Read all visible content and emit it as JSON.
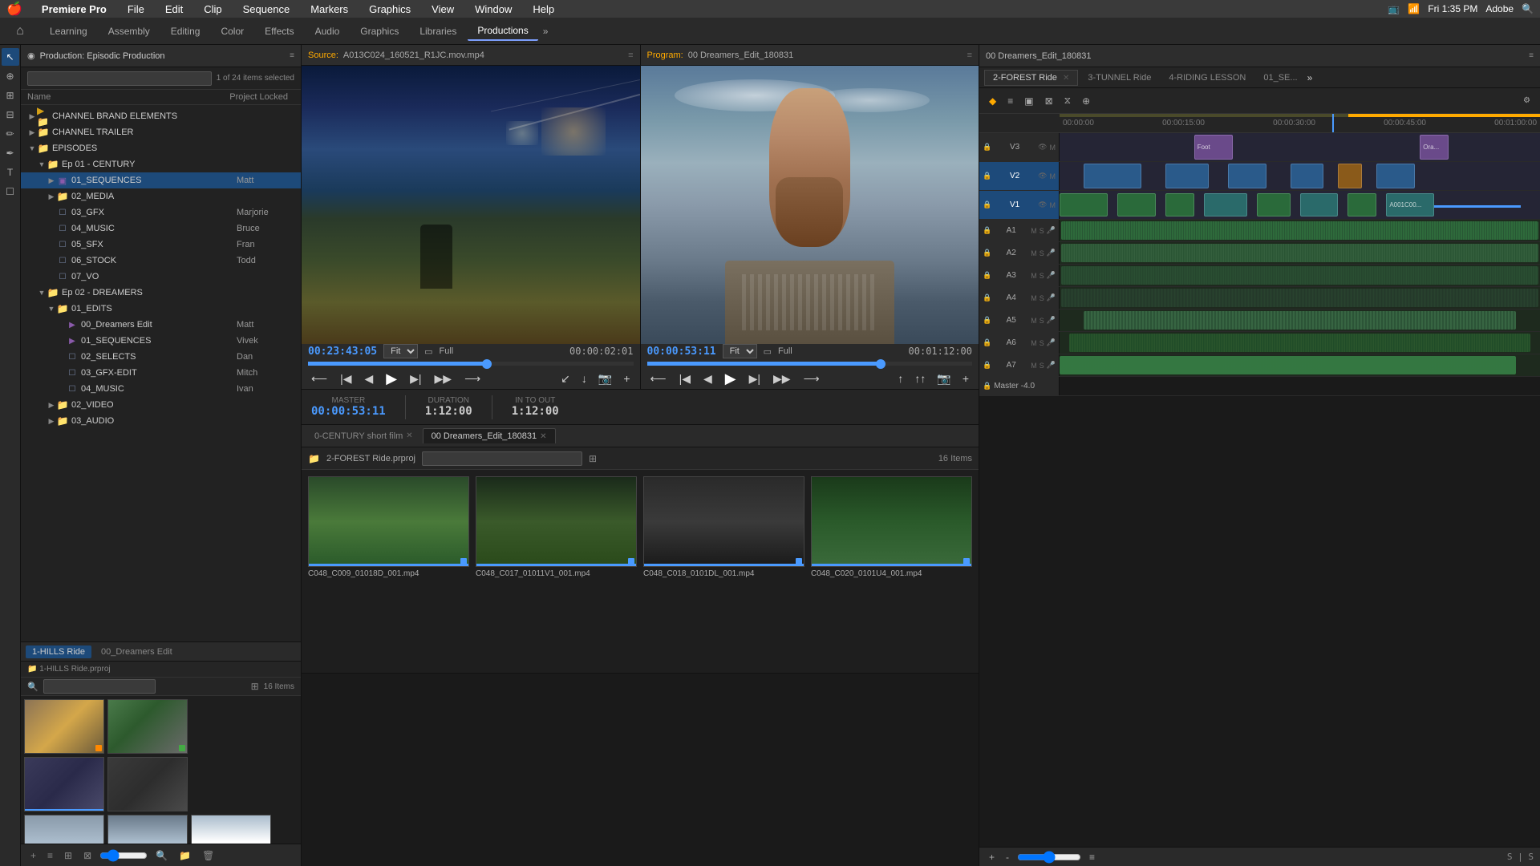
{
  "app": {
    "name": "Premiere Pro",
    "os_title": "Premiere Pro",
    "time": "Fri 1:35 PM",
    "adobe_label": "Adobe"
  },
  "menubar": {
    "apple": "🍎",
    "items": [
      "File",
      "Edit",
      "Clip",
      "Sequence",
      "Markers",
      "Graphics",
      "View",
      "Window",
      "Help"
    ],
    "app_name": "Premiere Pro"
  },
  "workspace": {
    "home_icon": "⌂",
    "tabs": [
      "Learning",
      "Assembly",
      "Editing",
      "Color",
      "Effects",
      "Audio",
      "Graphics",
      "Libraries",
      "Productions"
    ],
    "active_tab": "Productions",
    "more_icon": "»"
  },
  "project_panel": {
    "title": "Production: Episodic Production",
    "menu_icon": "≡",
    "search_placeholder": "",
    "item_count": "1 of 24 items selected",
    "col_name": "Name",
    "col_locked": "Project Locked",
    "tree": [
      {
        "level": 0,
        "type": "folder",
        "color": "yellow",
        "label": "CHANNEL BRAND ELEMENTS",
        "expanded": false
      },
      {
        "level": 0,
        "type": "folder",
        "color": "yellow",
        "label": "CHANNEL TRAILER",
        "expanded": false,
        "selected": true
      },
      {
        "level": 0,
        "type": "folder",
        "color": "yellow",
        "label": "EPISODES",
        "expanded": true
      },
      {
        "level": 1,
        "type": "folder",
        "color": "yellow",
        "label": "Ep 01 - CENTURY",
        "expanded": true
      },
      {
        "level": 2,
        "type": "folder",
        "color": "purple",
        "label": "01_SEQUENCES",
        "expanded": false,
        "user": "Matt",
        "selected": true
      },
      {
        "level": 2,
        "type": "folder",
        "color": "blue",
        "label": "02_MEDIA",
        "expanded": false
      },
      {
        "level": 2,
        "type": "bin",
        "label": "03_GFX",
        "user": "Marjorie"
      },
      {
        "level": 2,
        "type": "bin",
        "label": "04_MUSIC",
        "user": "Bruce"
      },
      {
        "level": 2,
        "type": "bin",
        "label": "05_SFX",
        "user": "Fran"
      },
      {
        "level": 2,
        "type": "bin",
        "label": "06_STOCK",
        "user": "Todd"
      },
      {
        "level": 2,
        "type": "bin",
        "label": "07_VO"
      },
      {
        "level": 1,
        "type": "folder",
        "color": "yellow",
        "label": "Ep 02 - DREAMERS",
        "expanded": true
      },
      {
        "level": 2,
        "type": "folder",
        "color": "blue",
        "label": "01_EDITS",
        "expanded": true
      },
      {
        "level": 3,
        "type": "seq",
        "label": "00_Dreamers Edit",
        "user": "Matt"
      },
      {
        "level": 3,
        "type": "seq",
        "label": "01_SEQUENCES",
        "user": "Vivek"
      },
      {
        "level": 3,
        "type": "bin",
        "label": "02_SELECTS",
        "user": "Dan"
      },
      {
        "level": 3,
        "type": "bin",
        "label": "03_GFX-EDIT",
        "user": "Mitch"
      },
      {
        "level": 3,
        "type": "bin",
        "label": "04_MUSIC",
        "user": "Ivan"
      },
      {
        "level": 2,
        "type": "folder",
        "color": "blue",
        "label": "02_VIDEO",
        "expanded": false
      },
      {
        "level": 2,
        "type": "folder",
        "color": "blue",
        "label": "03_AUDIO",
        "expanded": false
      }
    ]
  },
  "source_monitor": {
    "label": "Source:",
    "file": "A013C024_160521_R1JC.mov.mp4",
    "menu_icon": "≡",
    "timecode": "00:23:43:05",
    "fit": "Fit",
    "quality": "Full",
    "duration": "00:00:02:01"
  },
  "program_monitor": {
    "label": "Program:",
    "sequence": "00 Dreamers_Edit_180831",
    "menu_icon": "≡",
    "timecode": "00:00:53:11",
    "fit": "Fit",
    "quality": "Full",
    "duration": "00:01:12:00"
  },
  "markers_bar": {
    "label_master": "MASTER",
    "timecode_master": "00:00:53:11",
    "label_duration": "DURATION",
    "duration_val": "1:12:00",
    "label_in_out": "IN TO OUT",
    "in_out_val": "1:12:00",
    "master_timecode_blue": "00:00:53:11"
  },
  "bin_area": {
    "tabs": [
      {
        "label": "0-CENTURY short film",
        "active": false
      },
      {
        "label": "00 Dreamers_Edit_180831",
        "active": true
      }
    ],
    "search_placeholder": "",
    "item_count": "16 Items",
    "clips": [
      {
        "name": "C048_C009_01018D_001.mp4",
        "color": "green"
      },
      {
        "name": "C048_C017_01011V1_001.mp4",
        "color": "forest"
      },
      {
        "name": "C048_C018_0101DL_001.mp4",
        "color": "cycling"
      },
      {
        "name": "C048_C020_0101U4_001.mp4",
        "color": "forest2"
      }
    ]
  },
  "timeline": {
    "title": "00 Dreamers_Edit_180831",
    "menu_icon": "≡",
    "tabs": [
      {
        "label": "2-FOREST Ride",
        "active": true
      },
      {
        "label": "3-TUNNEL Ride"
      },
      {
        "label": "4-RIDING LESSON"
      },
      {
        "label": "01_SE..."
      }
    ],
    "more_icon": "»",
    "timecodes": [
      "00:00:00",
      "00:00:15:00",
      "00:00:30:00",
      "00:00:45:00",
      "00:01:00:00"
    ],
    "tracks": [
      {
        "id": "V3",
        "type": "video",
        "name": "V3"
      },
      {
        "id": "V2",
        "type": "video",
        "name": "V2"
      },
      {
        "id": "V1",
        "type": "video",
        "name": "V1"
      },
      {
        "id": "A1",
        "type": "audio",
        "name": "A1"
      },
      {
        "id": "A2",
        "type": "audio",
        "name": "A2"
      },
      {
        "id": "A3",
        "type": "audio",
        "name": "A3"
      },
      {
        "id": "A4",
        "type": "audio",
        "name": "A4"
      },
      {
        "id": "A5",
        "type": "audio",
        "name": "A5"
      },
      {
        "id": "A6",
        "type": "audio",
        "name": "A6"
      },
      {
        "id": "A7",
        "type": "audio",
        "name": "A7"
      }
    ],
    "master": {
      "label": "Master",
      "value": "-4.0"
    }
  },
  "bottom_panels": {
    "tabs": [
      "1-HILLS Ride",
      "00_Dreamers Edit"
    ],
    "active_tab": "1-HILLS Ride",
    "project_name": "1-HILLS Ride.prproj",
    "item_count": "16 Items"
  },
  "tools": {
    "items": [
      "↖",
      "✂",
      "☞",
      "B",
      "↕",
      "⟵",
      "T",
      "☐"
    ]
  }
}
